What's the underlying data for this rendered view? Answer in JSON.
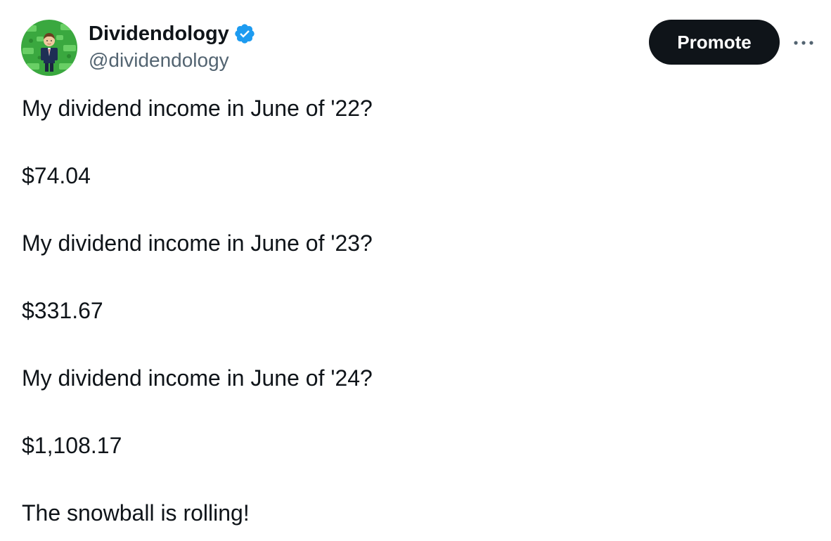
{
  "author": {
    "display_name": "Dividendology",
    "handle": "@dividendology",
    "verified_icon": "verified-badge-icon",
    "avatar_icon": "avatar-businessman-on-money"
  },
  "actions": {
    "promote_label": "Promote",
    "more_icon": "more-options-icon"
  },
  "tweet": {
    "lines": [
      "My dividend income in June of '22?",
      "$74.04",
      "My dividend income in June of '23?",
      "$331.67",
      "My dividend income in June of '24?",
      "$1,108.17",
      "The snowball is rolling!"
    ]
  },
  "colors": {
    "text_primary": "#0f1419",
    "text_secondary": "#536471",
    "verified_blue": "#1d9bf0",
    "button_bg": "#0f1419",
    "avatar_green": "#3aa83f"
  }
}
